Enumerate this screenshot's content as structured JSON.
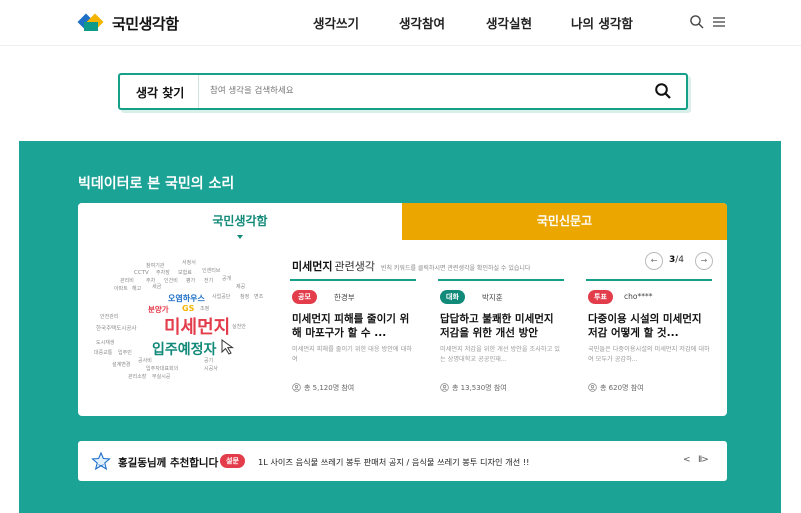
{
  "header": {
    "logo_text": "국민생각함",
    "nav": [
      "생각쓰기",
      "생각참여",
      "생각실현",
      "나의 생각함"
    ]
  },
  "search": {
    "label": "생각 찾기",
    "placeholder": "참여 생각을 검색하세요"
  },
  "bigdata": {
    "title": "빅데이터로 본 국민의 소리",
    "tabs": [
      "국민생각함",
      "국민신문고"
    ],
    "topic_keyword": "미세먼지",
    "topic_suffix": "관련생각",
    "topic_hint": "빈칙 키워드를 클릭하시면 관련생각을 확인하실 수 있습니다",
    "pager": {
      "current": "3",
      "total": "/4"
    },
    "cloud_words": [
      "참여기관",
      "서정서",
      "CCTV",
      "주차장",
      "보험료",
      "인센티브",
      "관리비",
      "주차",
      "인건비",
      "평가",
      "전기",
      "공개",
      "제공",
      "아파트",
      "해고",
      "세금",
      "오염하우스",
      "사업공단",
      "참정",
      "변조",
      "분양가",
      "GS",
      "조정",
      "미세먼지",
      "입주예정자",
      "실천안",
      "안전관리",
      "한국주택도시공사",
      "도시재생",
      "대중교통",
      "입주민",
      "공사비",
      "공기",
      "입주자대표회의",
      "시공사",
      "설계변경",
      "부실시공",
      "관리소장"
    ],
    "proposals": [
      {
        "badge": "공모",
        "badge_color": "#e33d4c",
        "author": "한경부",
        "title": "미세먼지 피해를 줄이기 위해 마포구가 할 수 ...",
        "desc": "미세먼지 피해를 줄이기 위한 대응 방안에 대하여",
        "count": "총 5,120명 참여"
      },
      {
        "badge": "대화",
        "badge_color": "#128a7a",
        "author": "박지훈",
        "title": "답답하고 불쾌한 미세먼지 저감을 위한 개선 방안",
        "desc": "미세먼지 저감을 위한 개선 방안을 조사하고 있는 상명대학교 공공인재...",
        "count": "총 13,530명 참여"
      },
      {
        "badge": "투표",
        "badge_color": "#e33d4c",
        "author": "cho****",
        "title": "다중이용 시설의 미세먼지 저감 어떻게 할 것...",
        "desc": "국민들은 다중이용시설의 미세먼지 저감에 대하여 모두가 공감하...",
        "count": "총 620명 참여"
      }
    ]
  },
  "recommend": {
    "title": "홍길동님께 추천합니다",
    "badge": "설문",
    "text": "1L 사이즈 음식물 쓰레기 봉투 판매처 공지 / 음식물 쓰레기 봉투 디자인 개선 !!",
    "prev": "<",
    "pause": "II>"
  },
  "colors": {
    "teal": "#1ba396",
    "accent_teal": "#128a7a",
    "tab_orange": "#eba600",
    "badge_red": "#e33d4c"
  }
}
